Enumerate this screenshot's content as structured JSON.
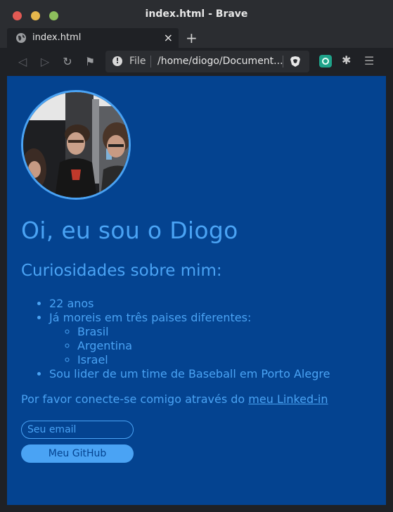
{
  "window": {
    "title": "index.html - Brave"
  },
  "tab": {
    "label": "index.html",
    "close": "×",
    "new_tab": "+"
  },
  "toolbar": {
    "back": "◁",
    "forward": "▷",
    "reload": "↻",
    "bookmark": "⚑"
  },
  "urlbar": {
    "scheme_label": "File",
    "url": "/home/diogo/Document..."
  },
  "page": {
    "name_heading": "Oi, eu sou o Diogo",
    "curiosities_heading": "Curiosidades sobre mim:",
    "facts": [
      "22 anos",
      "Já moreis em três paises diferentes:",
      "Sou lider de um time de Baseball em Porto Alegre"
    ],
    "countries": [
      "Brasil",
      "Argentina",
      "Israel"
    ],
    "connect_text": "Por favor conecte-se comigo através do ",
    "linkedin_link": "meu Linked-in",
    "email_placeholder": "Seu email",
    "github_button": "Meu GitHub"
  },
  "colors": {
    "page_background": "#044390",
    "accent": "#4aa3f4"
  }
}
